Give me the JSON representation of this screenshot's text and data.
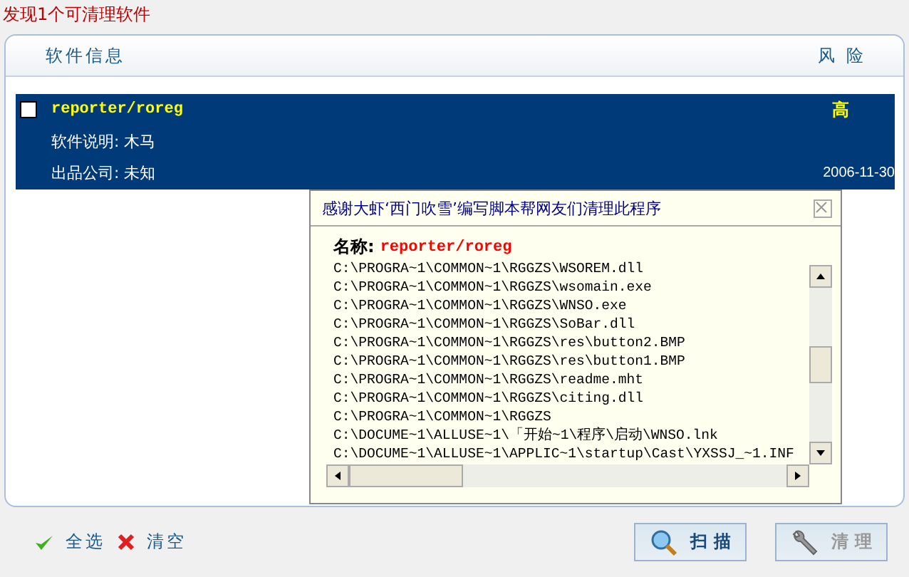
{
  "heading": "发现1个可清理软件",
  "table": {
    "columns": [
      "软件信息",
      "风 险"
    ],
    "rows": [
      {
        "name": "reporter/roreg",
        "checked": false,
        "selected": true,
        "risk": "高",
        "description": "软件说明: 木马",
        "company": "出品公司: 未知",
        "date": "2006-11-30"
      }
    ]
  },
  "popup": {
    "title": "感谢大虾‘西门吹雪’编写脚本帮网友们清理此程序",
    "name_label": "名称:",
    "name": "reporter/roreg",
    "files": [
      "C:\\PROGRA~1\\COMMON~1\\RGGZS\\WSOREM.dll",
      "C:\\PROGRA~1\\COMMON~1\\RGGZS\\wsomain.exe",
      "C:\\PROGRA~1\\COMMON~1\\RGGZS\\WNSO.exe",
      "C:\\PROGRA~1\\COMMON~1\\RGGZS\\SoBar.dll",
      "C:\\PROGRA~1\\COMMON~1\\RGGZS\\res\\button2.BMP",
      "C:\\PROGRA~1\\COMMON~1\\RGGZS\\res\\button1.BMP",
      "C:\\PROGRA~1\\COMMON~1\\RGGZS\\readme.mht",
      "C:\\PROGRA~1\\COMMON~1\\RGGZS\\citing.dll",
      "C:\\PROGRA~1\\COMMON~1\\RGGZS",
      "C:\\DOCUME~1\\ALLUSE~1\\「开始~1\\程序\\启动\\WNSO.lnk",
      "C:\\DOCUME~1\\ALLUSE~1\\APPLIC~1\\startup\\Cast\\YXSSJ_~1.INF"
    ]
  },
  "footer": {
    "select_all": "全选",
    "clear": "清空",
    "buttons": [
      {
        "kind": "scan",
        "label": "扫 描",
        "disabled": false
      },
      {
        "kind": "clean",
        "label": "清 理",
        "disabled": true
      }
    ]
  }
}
